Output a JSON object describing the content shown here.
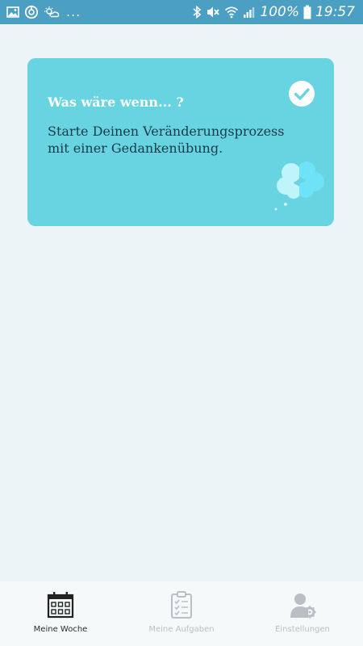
{
  "status_bar": {
    "battery": "100%",
    "time": "19:57",
    "more": "...",
    "background": "#4a9fc3"
  },
  "card": {
    "title": "Was wäre wenn... ?",
    "text": "Starte Deinen Veränderungsprozess mit einer Gedankenübung.",
    "completed": true,
    "background": "#68d4e1",
    "icons": [
      "check-circle-icon",
      "thought-cloud-icon"
    ]
  },
  "nav": {
    "items": [
      {
        "label": "Meine Woche",
        "icon": "calendar-icon",
        "active": true
      },
      {
        "label": "Meine Aufgaben",
        "icon": "checklist-icon",
        "active": false
      },
      {
        "label": "Einstellungen",
        "icon": "user-settings-icon",
        "active": false
      }
    ]
  }
}
